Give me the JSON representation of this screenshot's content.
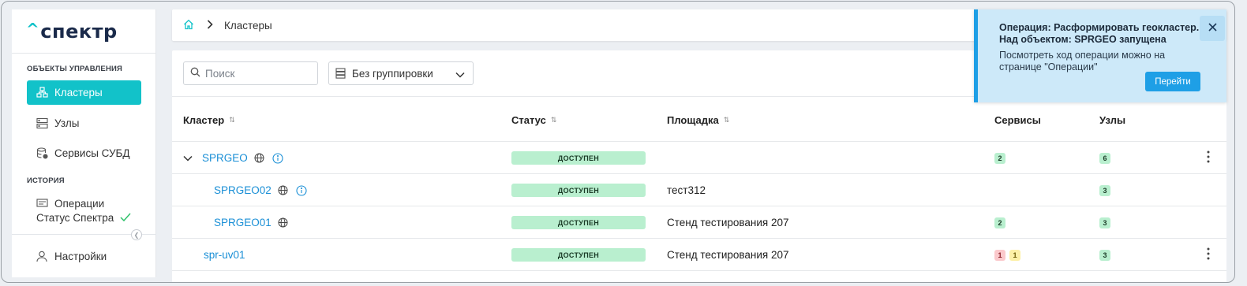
{
  "app": {
    "logo": "спектр"
  },
  "sidebar": {
    "sections": [
      {
        "title": "ОБЪЕКТЫ УПРАВЛЕНИЯ"
      },
      {
        "title": "ИСТОРИЯ"
      }
    ],
    "items": [
      {
        "label": "Кластеры",
        "icon": "cluster-icon",
        "active": true
      },
      {
        "label": "Узлы",
        "icon": "server-icon"
      },
      {
        "label": "Сервисы СУБД",
        "icon": "database-icon"
      },
      {
        "label": "Операции",
        "icon": "operations-icon"
      }
    ],
    "status_label": "Статус Спектра",
    "settings_label": "Настройки"
  },
  "breadcrumb": {
    "current": "Кластеры"
  },
  "toolbar": {
    "search_placeholder": "Поиск",
    "grouping": "Без группировки"
  },
  "table": {
    "columns": {
      "cluster": "Кластер",
      "status": "Статус",
      "site": "Площадка",
      "services": "Сервисы",
      "nodes": "Узлы"
    },
    "rows": [
      {
        "name": "SPRGEO",
        "status": "ДОСТУПЕН",
        "site": "",
        "services": [
          "2"
        ],
        "nodes": "6"
      },
      {
        "name": "SPRGEO02",
        "status": "ДОСТУПЕН",
        "site": "тест312",
        "services": [],
        "nodes": "3"
      },
      {
        "name": "SPRGEO01",
        "status": "ДОСТУПЕН",
        "site": "Стенд тестирования 207",
        "services": [
          "2"
        ],
        "nodes": "3"
      },
      {
        "name": "spr-uv01",
        "status": "ДОСТУПЕН",
        "site": "Стенд тестирования 207",
        "services_red": "1",
        "services_yellow": "1",
        "nodes": "3"
      }
    ]
  },
  "toast": {
    "title": "Операция: Расформировать геокластер. Над объектом: SPRGEO запущена",
    "body": "Посмотреть ход операции можно на странице \"Операции\"",
    "button": "Перейти"
  },
  "colors": {
    "accent": "#12c2c9",
    "link": "#1a8fd6",
    "toast_bg": "#cde9f9",
    "toast_accent": "#1e9fe6"
  }
}
